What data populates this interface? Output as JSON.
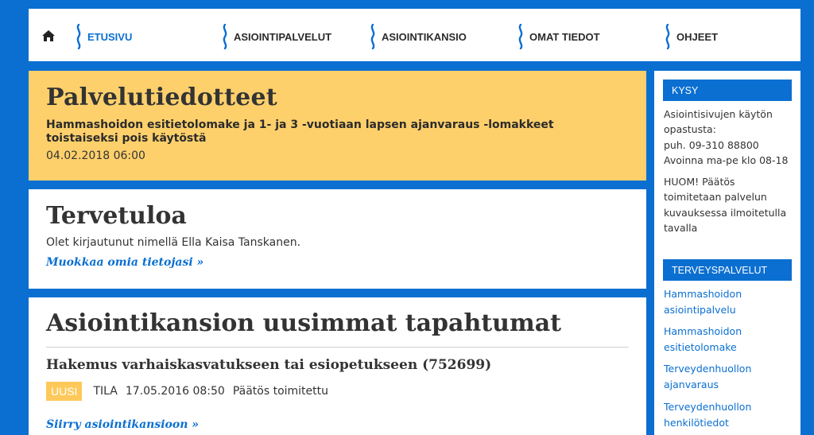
{
  "nav": {
    "home_icon": "home-icon",
    "items": [
      {
        "label": "ETUSIVU",
        "active": true
      },
      {
        "label": "ASIOINTIPALVELUT",
        "active": false
      },
      {
        "label": "ASIOINTIKANSIO",
        "active": false
      },
      {
        "label": "OMAT TIEDOT",
        "active": false
      },
      {
        "label": "OHJEET",
        "active": false
      }
    ]
  },
  "notice": {
    "title": "Palvelutiedotteet",
    "headline": "Hammashoidon esitietolomake ja 1- ja 3 -vuotiaan lapsen ajanvaraus -lomakkeet toistaiseksi pois käytöstä",
    "timestamp": "04.02.2018 06:00"
  },
  "welcome": {
    "title": "Tervetuloa",
    "text": "Olet kirjautunut nimellä Ella Kaisa Tanskanen.",
    "edit_link": "Muokkaa omia tietojasi »"
  },
  "events": {
    "title": "Asiointikansion uusimmat tapahtumat",
    "item": {
      "title": "Hakemus varhaiskasvatukseen tai esiopetukseen (752699)",
      "badge": "UUSI",
      "status_label": "TILA",
      "date": "17.05.2016 08:50",
      "status": "Päätös toimitettu"
    },
    "folder_link": "Siirry asiointikansioon »"
  },
  "sidebar": {
    "ask": {
      "heading": "KYSY",
      "lines": [
        "Asiointisivujen käytön",
        "opastusta:",
        "puh. 09-310 88800",
        "Avoinna ma-pe klo 08-18"
      ],
      "note_lines": [
        "HUOM! Päätös",
        "toimitetaan palvelun",
        "kuvauksessa ilmoitetulla",
        "tavalla"
      ]
    },
    "health": {
      "heading": "TERVEYSPALVELUT",
      "links": [
        [
          "Hammashoidon",
          "asiointipalvelu"
        ],
        [
          "Hammashoidon",
          "esitietolomake"
        ],
        [
          "Terveydenhuollon",
          "ajanvaraus"
        ],
        [
          "Terveydenhuollon",
          "henkilötiedot"
        ]
      ]
    }
  },
  "colors": {
    "brand_blue": "#0a6fd1",
    "notice_yellow": "#fed06b",
    "badge_yellow": "#fec95a"
  }
}
